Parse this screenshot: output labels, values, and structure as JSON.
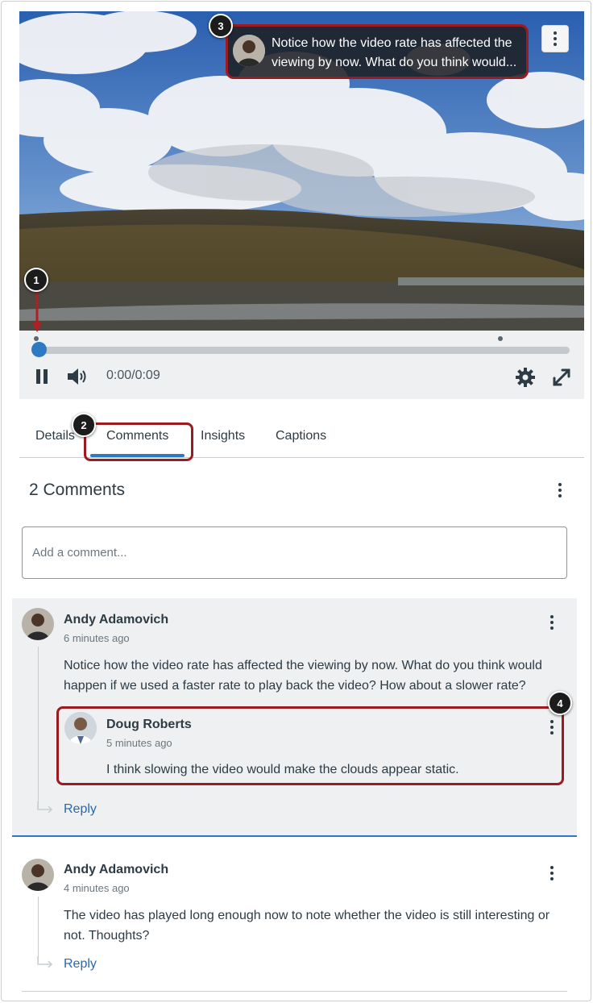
{
  "video": {
    "time_display": "0:00/0:09",
    "progress_fraction": 0.0
  },
  "tooltip": {
    "line1": "Notice how the video rate has affected the",
    "line2": "viewing by now. What do you think would..."
  },
  "callouts": [
    "1",
    "2",
    "3",
    "4"
  ],
  "tabs": [
    {
      "label": "Details"
    },
    {
      "label": "Comments",
      "active": true
    },
    {
      "label": "Insights"
    },
    {
      "label": "Captions"
    }
  ],
  "comments_header": {
    "count_label": "2 Comments"
  },
  "comment_input": {
    "placeholder": "Add a comment..."
  },
  "comments": [
    {
      "author": "Andy Adamovich",
      "time": "6 minutes ago",
      "text_line1": "Notice how the video rate has affected the viewing by now. What do you think would",
      "text_line2": "happen if we used a faster rate to play back the video? How about a slower rate?",
      "reply_label": "Reply",
      "replies": [
        {
          "author": "Doug Roberts",
          "time": "5 minutes ago",
          "text": "I think slowing the video would make the clouds appear static."
        }
      ]
    },
    {
      "author": "Andy Adamovich",
      "time": "4 minutes ago",
      "text_line1": "The video has played long enough now to note whether the video is still interesting or",
      "text_line2": "not. Thoughts?",
      "reply_label": "Reply"
    }
  ],
  "icons": {
    "pause": "pause-icon",
    "volume": "volume-icon",
    "settings": "gear-icon",
    "fullscreen": "fullscreen-icon",
    "menu": "kebab-menu-icon",
    "reply": "reply-arrow-icon"
  },
  "colors": {
    "accent": "#2d7ac2",
    "callout_border": "#9b1b20",
    "link": "#2c67a8"
  }
}
